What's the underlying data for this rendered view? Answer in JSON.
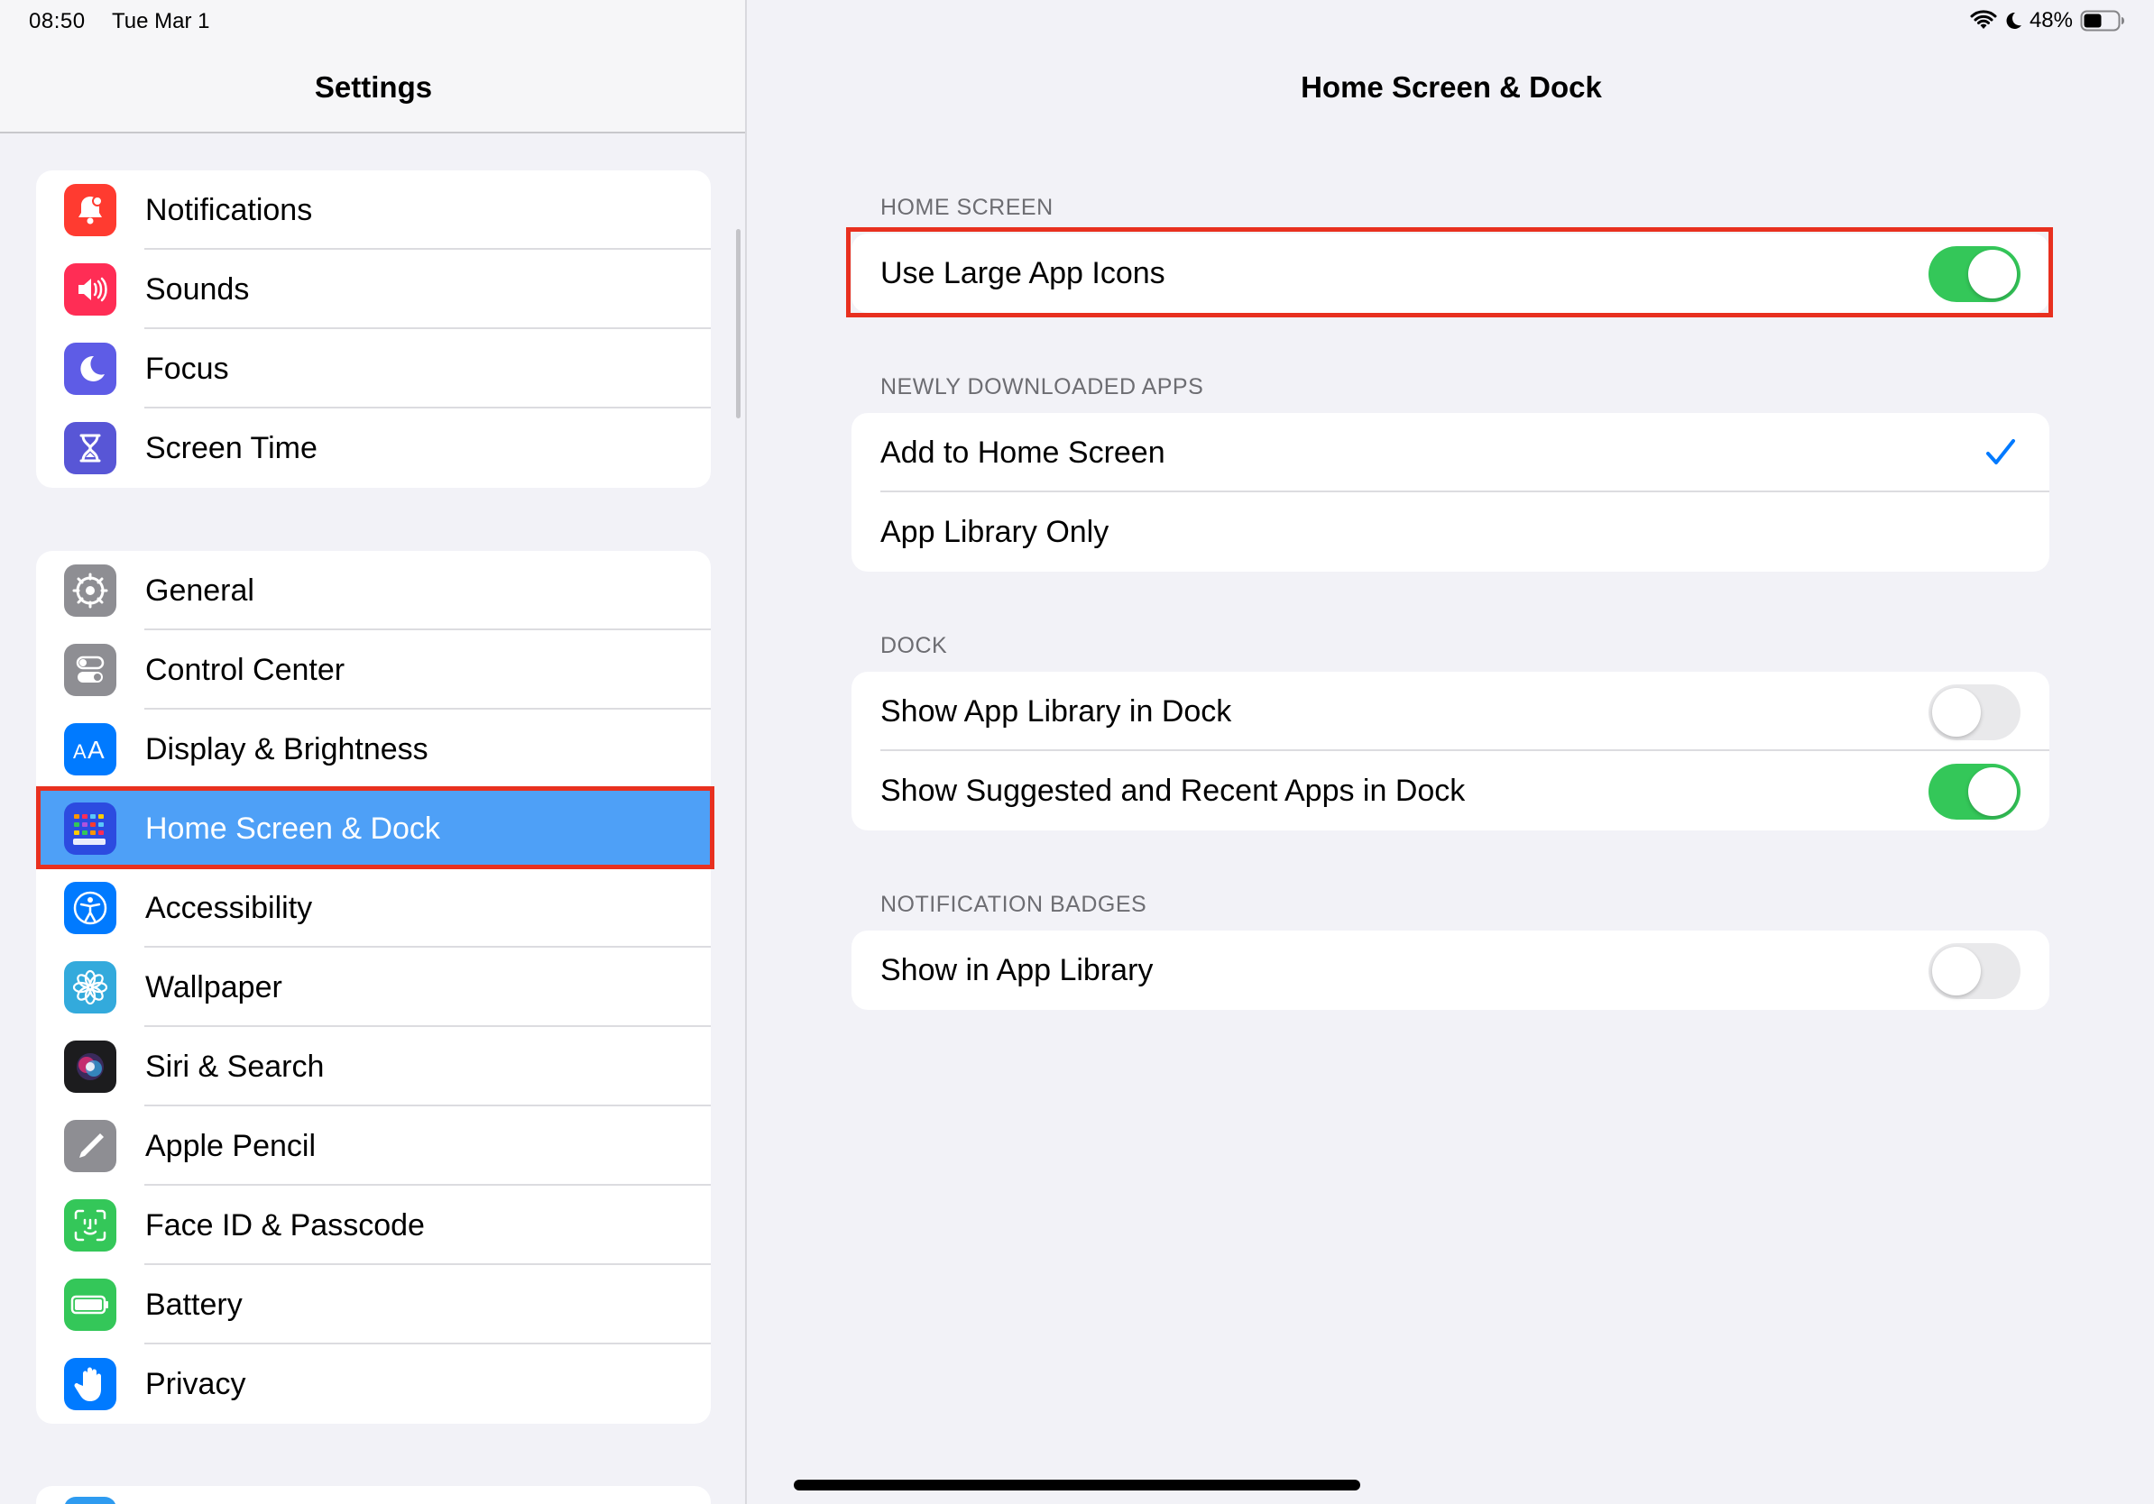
{
  "status_bar": {
    "time": "08:50",
    "date": "Tue Mar 1",
    "battery_percent": "48%",
    "icons": [
      "wifi-icon",
      "moon-icon",
      "battery-icon"
    ]
  },
  "sidebar": {
    "title": "Settings",
    "groups": [
      {
        "items": [
          {
            "label": "Notifications",
            "icon": "bell-icon",
            "color": "#ff3b30"
          },
          {
            "label": "Sounds",
            "icon": "speaker-icon",
            "color": "#ff2d55"
          },
          {
            "label": "Focus",
            "icon": "moon-icon",
            "color": "#5e5ce6"
          },
          {
            "label": "Screen Time",
            "icon": "hourglass-icon",
            "color": "#5856d6"
          }
        ]
      },
      {
        "items": [
          {
            "label": "General",
            "icon": "gear-icon",
            "color": "#8e8e93"
          },
          {
            "label": "Control Center",
            "icon": "switches-icon",
            "color": "#8e8e93"
          },
          {
            "label": "Display & Brightness",
            "icon": "text-size-icon",
            "color": "#007aff"
          },
          {
            "label": "Home Screen & Dock",
            "icon": "app-grid-icon",
            "color": "#2c4be0",
            "selected": true
          },
          {
            "label": "Accessibility",
            "icon": "accessibility-icon",
            "color": "#007aff"
          },
          {
            "label": "Wallpaper",
            "icon": "flower-icon",
            "color": "#33aadc"
          },
          {
            "label": "Siri & Search",
            "icon": "siri-icon",
            "color": "#1c1c1e"
          },
          {
            "label": "Apple Pencil",
            "icon": "pencil-icon",
            "color": "#8e8e93"
          },
          {
            "label": "Face ID & Passcode",
            "icon": "face-id-icon",
            "color": "#34c759"
          },
          {
            "label": "Battery",
            "icon": "battery-icon",
            "color": "#34c759"
          },
          {
            "label": "Privacy",
            "icon": "hand-icon",
            "color": "#007aff"
          }
        ]
      }
    ]
  },
  "detail": {
    "title": "Home Screen & Dock",
    "sections": [
      {
        "header": "HOME SCREEN",
        "rows": [
          {
            "label": "Use Large App Icons",
            "control": "toggle",
            "on": true
          }
        ]
      },
      {
        "header": "NEWLY DOWNLOADED APPS",
        "rows": [
          {
            "label": "Add to Home Screen",
            "control": "check",
            "checked": true
          },
          {
            "label": "App Library Only",
            "control": "check",
            "checked": false
          }
        ]
      },
      {
        "header": "DOCK",
        "rows": [
          {
            "label": "Show App Library in Dock",
            "control": "toggle",
            "on": false
          },
          {
            "label": "Show Suggested and Recent Apps in Dock",
            "control": "toggle",
            "on": true
          }
        ]
      },
      {
        "header": "NOTIFICATION BADGES",
        "rows": [
          {
            "label": "Show in App Library",
            "control": "toggle",
            "on": false
          }
        ]
      }
    ]
  },
  "colors": {
    "toggle_on": "#34c759",
    "toggle_off": "#e9e9eb",
    "selection": "#4ea0f7",
    "highlight": "#e8301f",
    "checkmark": "#007aff"
  }
}
